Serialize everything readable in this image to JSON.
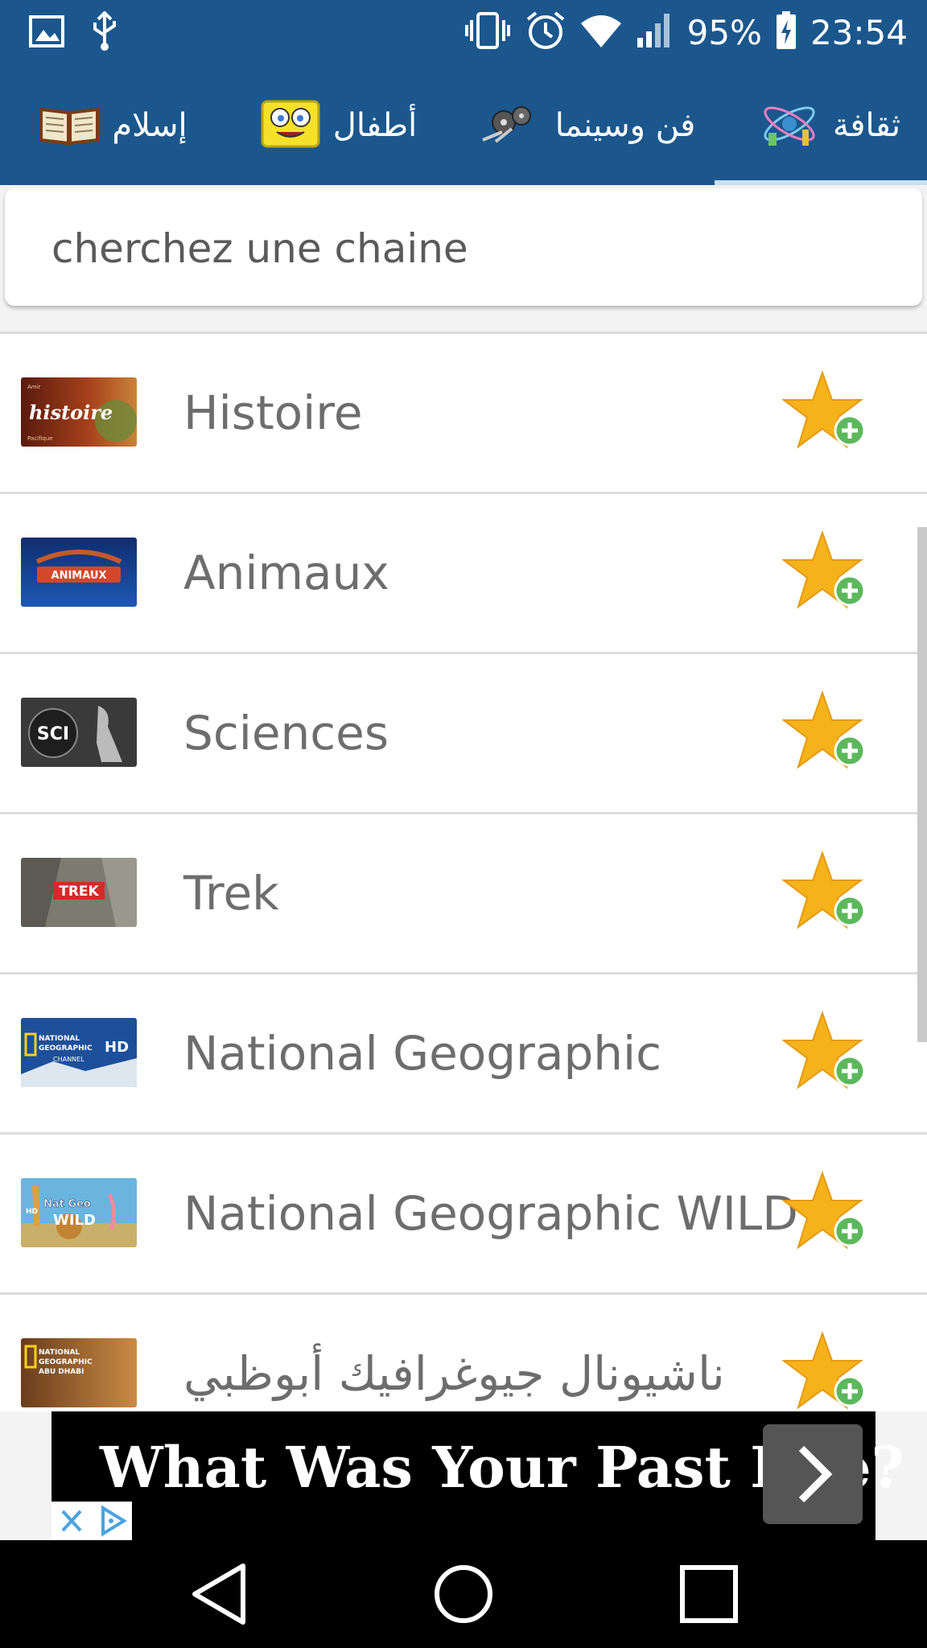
{
  "status_bar": {
    "battery": "95%",
    "time": "23:54"
  },
  "tabs": [
    {
      "label": "إسلام",
      "icon": "book-icon"
    },
    {
      "label": "أطفال",
      "icon": "spongebob-icon"
    },
    {
      "label": "فن وسينما",
      "icon": "film-reel-icon"
    },
    {
      "label": "ثقافة",
      "icon": "science-icon",
      "selected": true
    }
  ],
  "search": {
    "placeholder": "cherchez une chaine",
    "value": ""
  },
  "channels": [
    {
      "name": "Histoire",
      "logo_text": "histoire"
    },
    {
      "name": "Animaux",
      "logo_text": "ANIMAUX"
    },
    {
      "name": "Sciences",
      "logo_text": "SCI"
    },
    {
      "name": "Trek",
      "logo_text": "TREK"
    },
    {
      "name": "National Geographic",
      "logo_text": "NATIONAL GEOGRAPHIC HD"
    },
    {
      "name": "National Geographic WILD",
      "logo_text": "Nat Geo WILD"
    },
    {
      "name": "ناشيونال جيوغرافيك أبوظبي",
      "logo_text": "NATIONAL GEOGRAPHIC ABU DHABI"
    }
  ],
  "ad": {
    "text": "What Was Your Past Life?"
  },
  "colors": {
    "primary": "#1b578d",
    "tab_indicator": "#c9dfee",
    "divider": "#dcdcdc",
    "star": "#f6b21b",
    "plus": "#5cb85c"
  }
}
